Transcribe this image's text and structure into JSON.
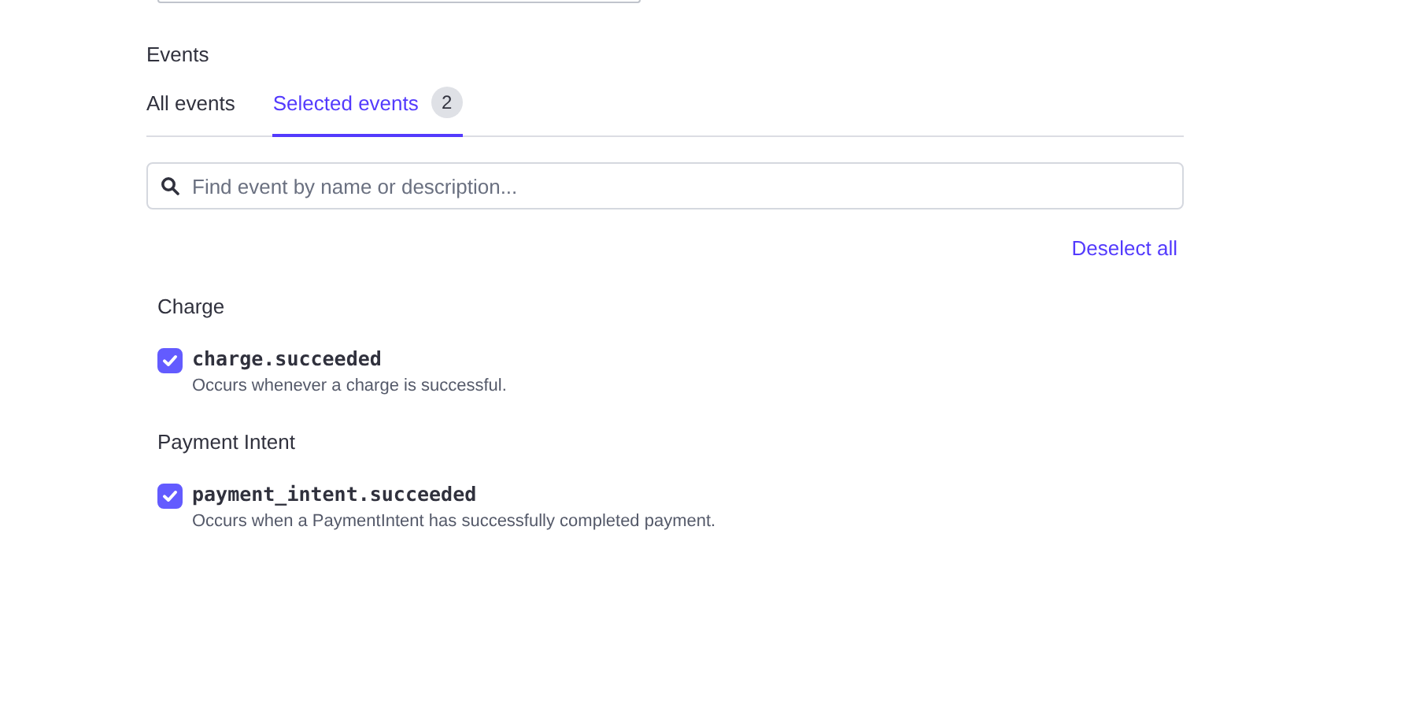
{
  "section_label": "Events",
  "tabs": [
    {
      "label": "All events",
      "selected": false
    },
    {
      "label": "Selected events",
      "selected": true,
      "badge": "2"
    }
  ],
  "search": {
    "placeholder": "Find event by name or description..."
  },
  "deselect_all": "Deselect all",
  "groups": [
    {
      "title": "Charge",
      "events": [
        {
          "name": "charge.succeeded",
          "description": "Occurs whenever a charge is successful.",
          "checked": true
        }
      ]
    },
    {
      "title": "Payment Intent",
      "events": [
        {
          "name": "payment_intent.succeeded",
          "description": "Occurs when a PaymentIntent has successfully completed payment.",
          "checked": true
        }
      ]
    }
  ]
}
